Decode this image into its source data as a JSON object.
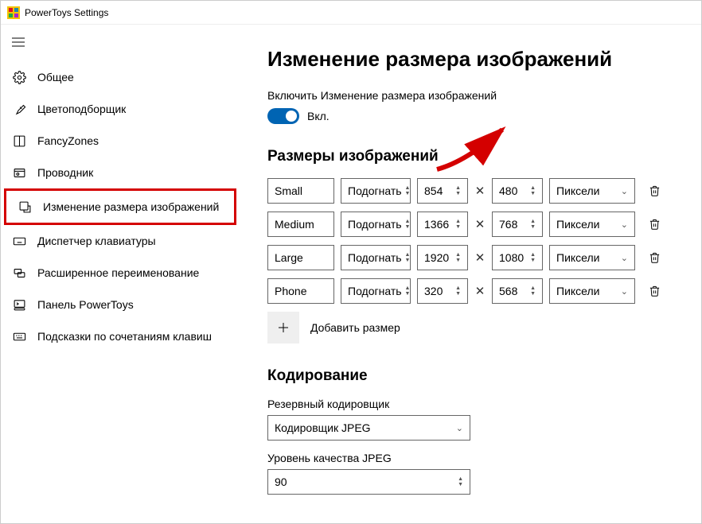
{
  "title": "PowerToys Settings",
  "sidebar": {
    "items": [
      {
        "label": "Общее"
      },
      {
        "label": "Цветоподборщик"
      },
      {
        "label": "FancyZones"
      },
      {
        "label": "Проводник"
      },
      {
        "label": "Изменение размера изображений"
      },
      {
        "label": "Диспетчер клавиатуры"
      },
      {
        "label": "Расширенное переименование"
      },
      {
        "label": "Панель PowerToys"
      },
      {
        "label": "Подсказки по сочетаниям клавиш"
      }
    ]
  },
  "page": {
    "heading": "Изменение размера изображений",
    "enable_label": "Включить Изменение размера изображений",
    "toggle_state": "Вкл.",
    "sizes_heading": "Размеры изображений",
    "sizes": [
      {
        "name": "Small",
        "fit": "Подогнать",
        "w": "854",
        "h": "480",
        "unit": "Пиксели"
      },
      {
        "name": "Medium",
        "fit": "Подогнать",
        "w": "1366",
        "h": "768",
        "unit": "Пиксели"
      },
      {
        "name": "Large",
        "fit": "Подогнать",
        "w": "1920",
        "h": "1080",
        "unit": "Пиксели"
      },
      {
        "name": "Phone",
        "fit": "Подогнать",
        "w": "320",
        "h": "568",
        "unit": "Пиксели"
      }
    ],
    "add_size_label": "Добавить размер",
    "encoding_heading": "Кодирование",
    "fallback_label": "Резервный кодировщик",
    "fallback_value": "Кодировщик JPEG",
    "quality_label": "Уровень качества JPEG",
    "quality_value": "90"
  }
}
